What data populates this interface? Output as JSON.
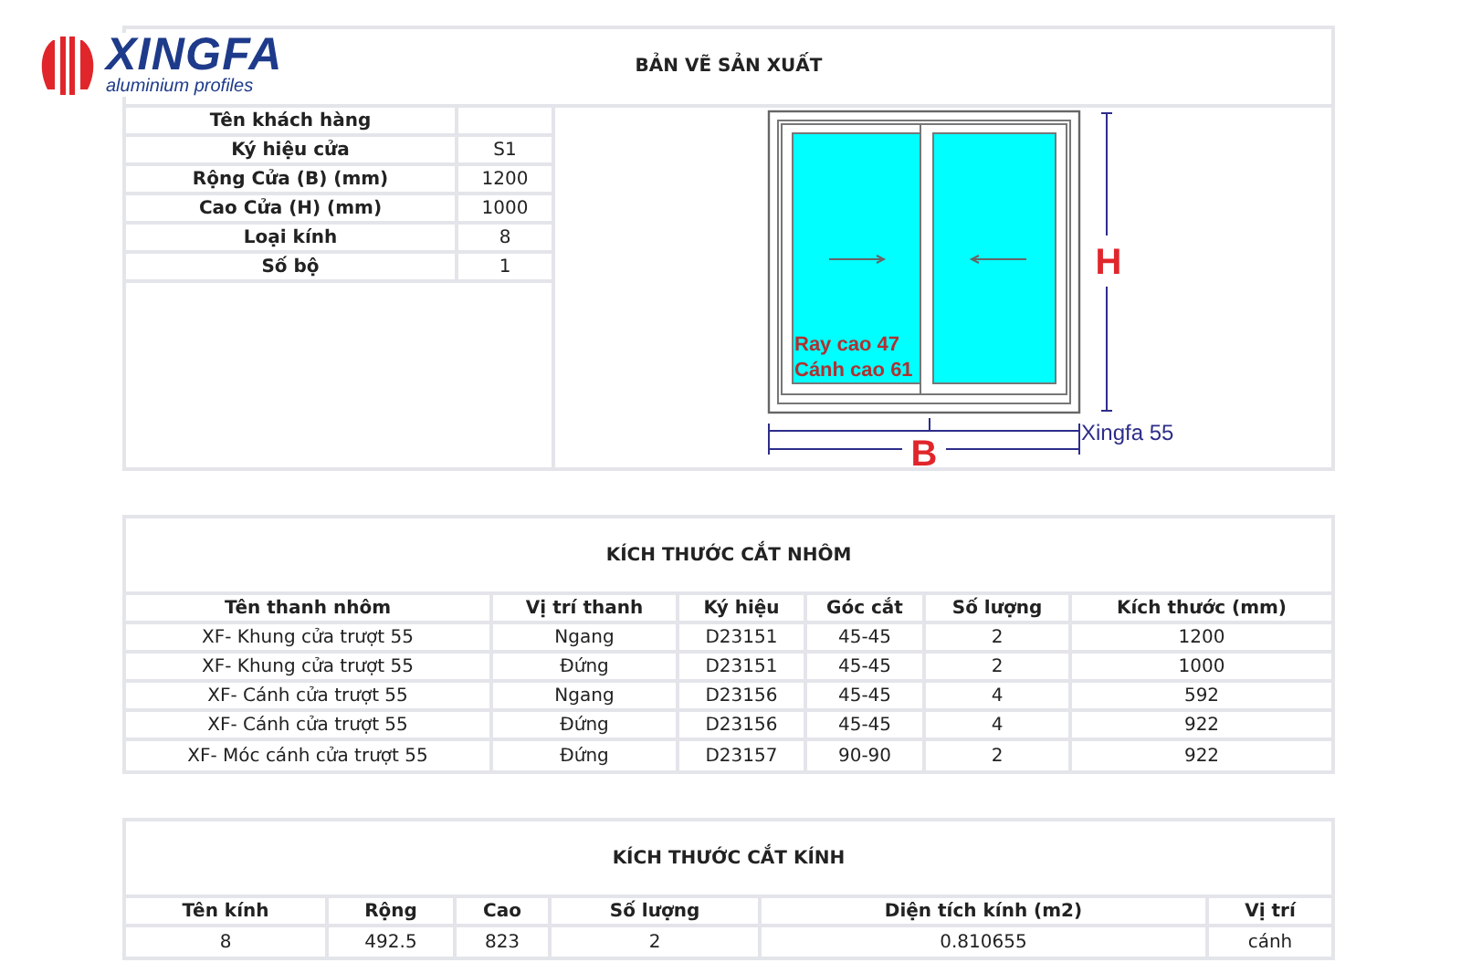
{
  "logo": {
    "name": "XINGFA",
    "tagline": "aluminium profiles"
  },
  "drawing_section": {
    "title": "BẢN VẼ SẢN XUẤT",
    "specs": [
      {
        "label": "Tên khách hàng"
      },
      {
        "label": "Ký hiệu cửa",
        "value": "S1"
      },
      {
        "label": "Rộng Cửa (B) (mm)",
        "value": "1200"
      },
      {
        "label": "Cao Cửa (H) (mm)",
        "value": "1000"
      },
      {
        "label": "Loại kính",
        "value": "8"
      },
      {
        "label": "Số bộ",
        "value": "1"
      }
    ],
    "diagram": {
      "height_label": "H",
      "width_label": "B",
      "rail_note": "Ray cao 47",
      "sash_note": "Cánh cao 61",
      "system": "Xingfa 55"
    }
  },
  "aluminium_section": {
    "title": "KÍCH THƯỚC CẮT NHÔM",
    "columns": [
      "Tên thanh nhôm",
      "Vị trí thanh",
      "Ký hiệu",
      "Góc cắt",
      "Số lượng",
      "Kích thước (mm)"
    ],
    "rows": [
      [
        "XF- Khung cửa trượt 55",
        "Ngang",
        "D23151",
        "45-45",
        "2",
        "1200"
      ],
      [
        "XF- Khung cửa trượt 55",
        "Đứng",
        "D23151",
        "45-45",
        "2",
        "1000"
      ],
      [
        "XF- Cánh cửa trượt 55",
        "Ngang",
        "D23156",
        "45-45",
        "4",
        "592"
      ],
      [
        "XF- Cánh cửa trượt 55",
        "Đứng",
        "D23156",
        "45-45",
        "4",
        "922"
      ],
      [
        "XF- Móc cánh cửa trượt 55",
        "Đứng",
        "D23157",
        "90-90",
        "2",
        "922"
      ]
    ]
  },
  "glass_section": {
    "title": "KÍCH THƯỚC CẮT KÍNH",
    "columns": [
      "Tên kính",
      "Rộng",
      "Cao",
      "Số lượng",
      "Diện tích kính (m2)",
      "Vị trí"
    ],
    "rows": [
      [
        "8",
        "492.5",
        "823",
        "2",
        "0.810655",
        "cánh"
      ]
    ]
  }
}
